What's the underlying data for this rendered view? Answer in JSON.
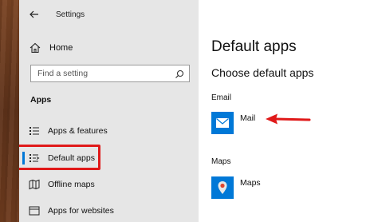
{
  "window": {
    "title": "Settings"
  },
  "sidebar": {
    "home_label": "Home",
    "search_placeholder": "Find a setting",
    "section_label": "Apps",
    "items": [
      {
        "label": "Apps & features",
        "icon": "list-icon"
      },
      {
        "label": "Default apps",
        "icon": "default-apps-icon",
        "selected": true
      },
      {
        "label": "Offline maps",
        "icon": "offline-maps-icon"
      },
      {
        "label": "Apps for websites",
        "icon": "apps-for-websites-icon"
      }
    ]
  },
  "main": {
    "page_title": "Default apps",
    "subtitle": "Choose default apps",
    "categories": [
      {
        "label": "Email",
        "app": "Mail",
        "icon": "mail-icon"
      },
      {
        "label": "Maps",
        "app": "Maps",
        "icon": "map-pin-icon"
      }
    ]
  },
  "colors": {
    "accent": "#0078d7",
    "annotation_red": "#e01919"
  }
}
